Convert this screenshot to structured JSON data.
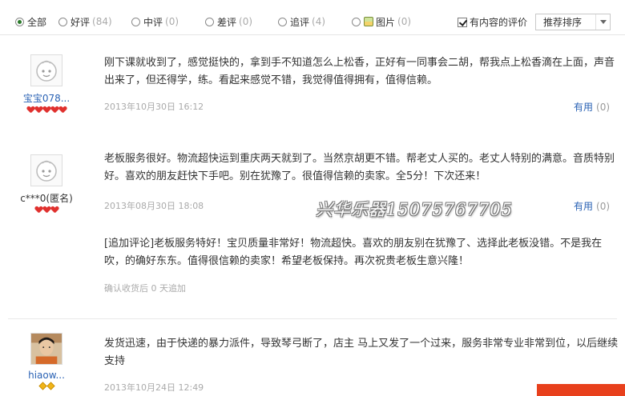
{
  "filters": {
    "all": {
      "label": "全部"
    },
    "good": {
      "label": "好评",
      "count": "(84)"
    },
    "medium": {
      "label": "中评",
      "count": "(0)"
    },
    "bad": {
      "label": "差评",
      "count": "(0)"
    },
    "append": {
      "label": "追评",
      "count": "(4)"
    },
    "pictures": {
      "label": "图片",
      "count": "(0)"
    },
    "has_content_label": "有内容的评价",
    "has_content_checked": true,
    "sort_value": "推荐排序"
  },
  "reviews": [
    {
      "username": "宝宝078...",
      "badge_type": "heart",
      "badge_count": 5,
      "text": "刚下课就收到了，感觉挺快的，拿到手不知道怎么上松香，正好有一同事会二胡，帮我点上松香滴在上面，声音出来了，但还得学，练。看起来感觉不错，我觉得值得拥有，值得信赖。",
      "date": "2013年10月30日 16:12",
      "useful_label": "有用",
      "useful_count": "(0)"
    },
    {
      "username": "c***0(匿名)",
      "badge_type": "heart",
      "badge_count": 3,
      "text": "老板服务很好。物流超快运到重庆两天就到了。当然京胡更不错。帮老丈人买的。老丈人特别的满意。音质特别好。喜欢的朋友赶快下手吧。别在犹豫了。很值得信赖的卖家。全5分！下次还来！",
      "date": "2013年08月30日 18:08",
      "useful_label": "有用",
      "useful_count": "(0)",
      "append_text": "[追加评论]老板服务特好！宝贝质量非常好！物流超快。喜欢的朋友别在犹豫了、选择此老板没错。不是我在吹，的确好东东。值得很信赖的卖家！希望老板保持。再次祝贵老板生意兴隆！",
      "append_meta": "确认收货后 0 天追加"
    },
    {
      "username": "hiaow...",
      "badge_type": "diamond",
      "badge_count": 2,
      "text": "发货迅速，由于快递的暴力派件，导致琴弓断了，店主 马上又发了一个过来，服务非常专业非常到位，以后继续支持",
      "date": "2013年10月24日 12:49"
    }
  ],
  "watermark": "兴华乐器15075767705",
  "colors": {
    "link": "#2a62b4",
    "muted": "#aaaaaa",
    "badge_heart": "#e0312e",
    "badge_diamond": "#f0b418",
    "accent_bar": "#e8401c"
  }
}
